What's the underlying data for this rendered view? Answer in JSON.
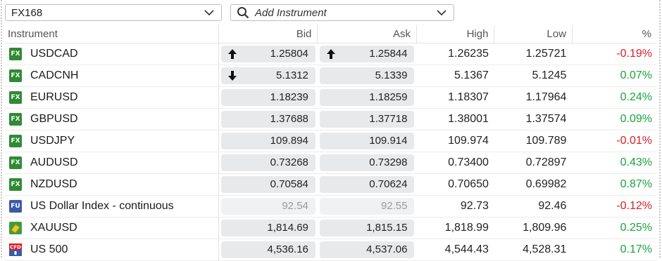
{
  "toolbar": {
    "list_value": "FX168",
    "instrument_placeholder": "Add Instrument"
  },
  "columns": {
    "instrument": "Instrument",
    "bid": "Bid",
    "ask": "Ask",
    "high": "High",
    "low": "Low",
    "pct": "%"
  },
  "rows": [
    {
      "badge": "FX",
      "badge_type": "fx",
      "name": "USDCAD",
      "bid": "1.25804",
      "ask": "1.25844",
      "high": "1.26235",
      "low": "1.25721",
      "pct": "-0.19%",
      "direction": "neg",
      "bid_arrow": "up",
      "ask_arrow": "up"
    },
    {
      "badge": "FX",
      "badge_type": "fx",
      "name": "CADCNH",
      "bid": "5.1312",
      "ask": "5.1339",
      "high": "5.1367",
      "low": "5.1245",
      "pct": "0.07%",
      "direction": "pos",
      "bid_arrow": "down",
      "ask_arrow": ""
    },
    {
      "badge": "FX",
      "badge_type": "fx",
      "name": "EURUSD",
      "bid": "1.18239",
      "ask": "1.18259",
      "high": "1.18307",
      "low": "1.17964",
      "pct": "0.24%",
      "direction": "pos",
      "bid_arrow": "",
      "ask_arrow": ""
    },
    {
      "badge": "FX",
      "badge_type": "fx",
      "name": "GBPUSD",
      "bid": "1.37688",
      "ask": "1.37718",
      "high": "1.38001",
      "low": "1.37574",
      "pct": "0.09%",
      "direction": "pos",
      "bid_arrow": "",
      "ask_arrow": ""
    },
    {
      "badge": "FX",
      "badge_type": "fx",
      "name": "USDJPY",
      "bid": "109.894",
      "ask": "109.914",
      "high": "109.974",
      "low": "109.789",
      "pct": "-0.01%",
      "direction": "neg",
      "bid_arrow": "",
      "ask_arrow": ""
    },
    {
      "badge": "FX",
      "badge_type": "fx",
      "name": "AUDUSD",
      "bid": "0.73268",
      "ask": "0.73298",
      "high": "0.73400",
      "low": "0.72897",
      "pct": "0.43%",
      "direction": "pos",
      "bid_arrow": "",
      "ask_arrow": ""
    },
    {
      "badge": "FX",
      "badge_type": "fx",
      "name": "NZDUSD",
      "bid": "0.70584",
      "ask": "0.70624",
      "high": "0.70650",
      "low": "0.69982",
      "pct": "0.87%",
      "direction": "pos",
      "bid_arrow": "",
      "ask_arrow": ""
    },
    {
      "badge": "FU",
      "badge_type": "fu",
      "name": "US Dollar Index - continuous",
      "bid": "92.54",
      "ask": "92.55",
      "high": "92.73",
      "low": "92.46",
      "pct": "-0.12%",
      "direction": "neg",
      "bid_arrow": "",
      "ask_arrow": "",
      "muted": true
    },
    {
      "badge": "",
      "badge_type": "gold",
      "name": "XAUUSD",
      "bid": "1,814.69",
      "ask": "1,815.15",
      "high": "1,818.99",
      "low": "1,809.96",
      "pct": "0.25%",
      "direction": "pos",
      "bid_arrow": "",
      "ask_arrow": ""
    },
    {
      "badge": "CFD",
      "badge_type": "cfd",
      "name": "US 500",
      "bid": "4,536.16",
      "ask": "4,537.06",
      "high": "4,544.43",
      "low": "4,528.31",
      "pct": "0.17%",
      "direction": "pos",
      "bid_arrow": "",
      "ask_arrow": ""
    }
  ],
  "colors": {
    "positive": "#1aa23c",
    "negative": "#d81f26",
    "fx_badge": "#2f8a36",
    "fu_badge": "#3b5aa6"
  },
  "icons": {
    "dropdown": "chevron-down-icon",
    "search": "search-icon",
    "up": "arrow-up-icon",
    "down": "arrow-down-icon"
  }
}
